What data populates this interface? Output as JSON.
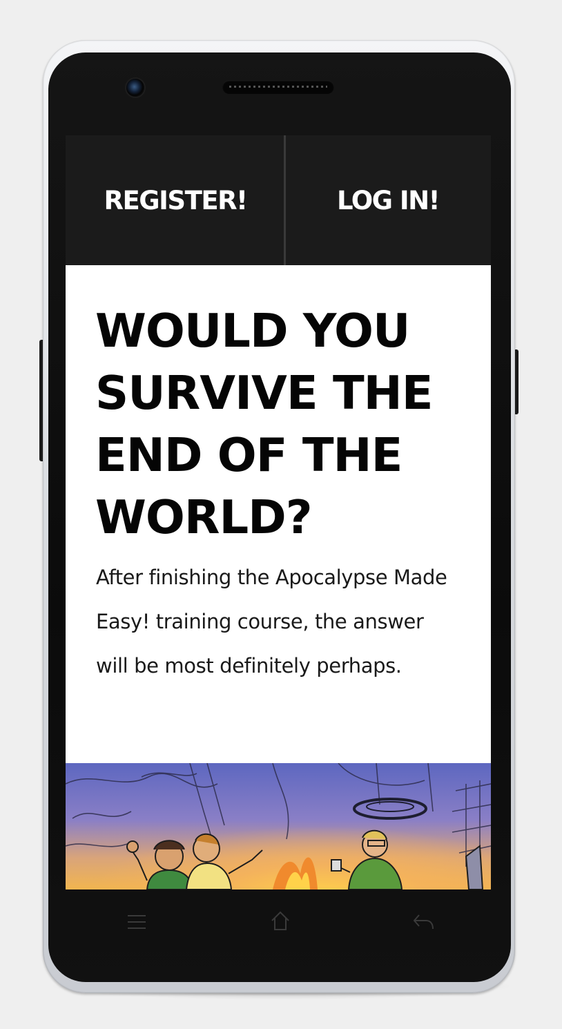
{
  "nav": {
    "register_label": "REGISTER!",
    "login_label": "LOG IN!"
  },
  "main": {
    "headline": "WOULD YOU SURVIVE THE END OF THE WORLD?",
    "intro": "After finishing the Apocalypse Made Easy! training course, the answer will be most definitely perhaps."
  },
  "device": {
    "nav_icons": [
      "menu-icon",
      "home-icon",
      "back-icon"
    ]
  },
  "colors": {
    "nav_background": "#1b1b1b",
    "headline_text": "#050505",
    "page_background": "#ffffff"
  }
}
